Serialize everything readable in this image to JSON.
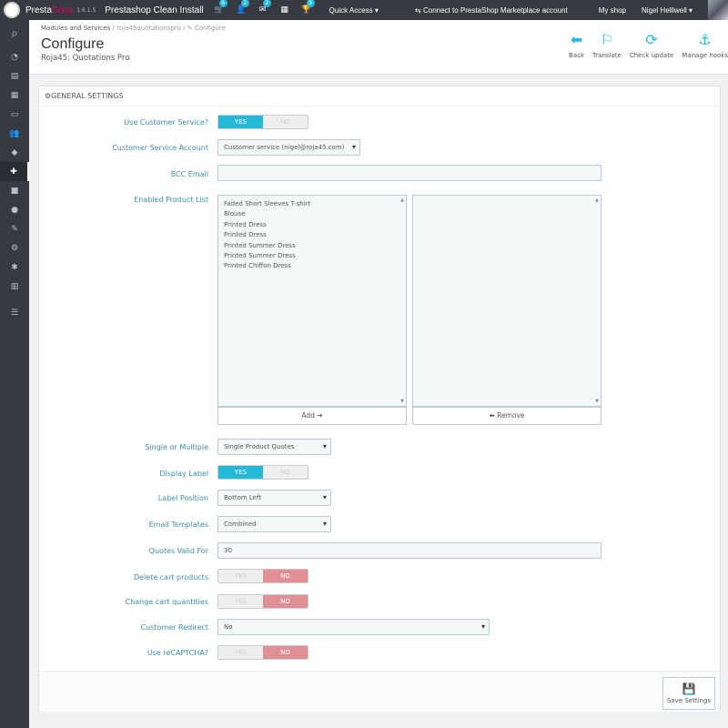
{
  "topbar": {
    "brand_presta": "Presta",
    "brand_shop": "Shop",
    "version": "1.6.1.5",
    "store_name": "Prestashop Clean Install",
    "badges": [
      "6",
      "2",
      "2",
      "9"
    ],
    "quick_access": "Quick Access ▾",
    "marketplace": "Connect to PrestaShop Marketplace account",
    "my_shop": "My shop",
    "user": "Nigel Helliwell ▾"
  },
  "breadcrumb": {
    "part1": "Modules and Services",
    "sep": "/",
    "part2": "roja45quotationspro",
    "part3": "Configure"
  },
  "header": {
    "title": "Configure",
    "subtitle": "Roja45: Quotations Pro"
  },
  "toolbar": {
    "back": "Back",
    "translate": "Translate",
    "check_update": "Check update",
    "manage_hooks": "Manage hooks"
  },
  "panel": {
    "heading": "GENERAL SETTINGS"
  },
  "labels": {
    "use_customer_service": "Use Customer Service?",
    "customer_service_account": "Customer Service Account",
    "bcc_email": "BCC Email",
    "enabled_product_list": "Enabled Product List",
    "single_or_multiple": "Single or Multiple",
    "display_label": "Display Label",
    "label_position": "Label Position",
    "email_templates": "Email Templates",
    "quotes_valid_for": "Quotes Valid For",
    "delete_cart_products": "Delete cart products",
    "change_cart_quantities": "Change cart quantities",
    "customer_redirect": "Customer Redirect",
    "use_recaptcha": "Use reCAPTCHA?"
  },
  "switch_text": {
    "yes": "YES",
    "no": "NO"
  },
  "values": {
    "customer_service_account": "Customer service (nigel@roja45.com)",
    "bcc_email": "",
    "single_or_multiple": "Single Product Quotes",
    "label_position": "Bottom Left",
    "email_templates": "Combined",
    "quotes_valid_for": "30",
    "customer_redirect": "No"
  },
  "products": [
    "Faded Short Sleeves T-shirt",
    "Blouse",
    "Printed Dress",
    "Printed Dress",
    "Printed Summer Dress",
    "Printed Summer Dress",
    "Printed Chiffon Dress"
  ],
  "buttons": {
    "add": "Add ➔",
    "remove": "⬅ Remove",
    "save": "Save Settings"
  },
  "colors": {
    "accent": "#25b9d7",
    "danger": "#e08f95",
    "label": "#3a8ea8",
    "topbar": "#363a41"
  }
}
